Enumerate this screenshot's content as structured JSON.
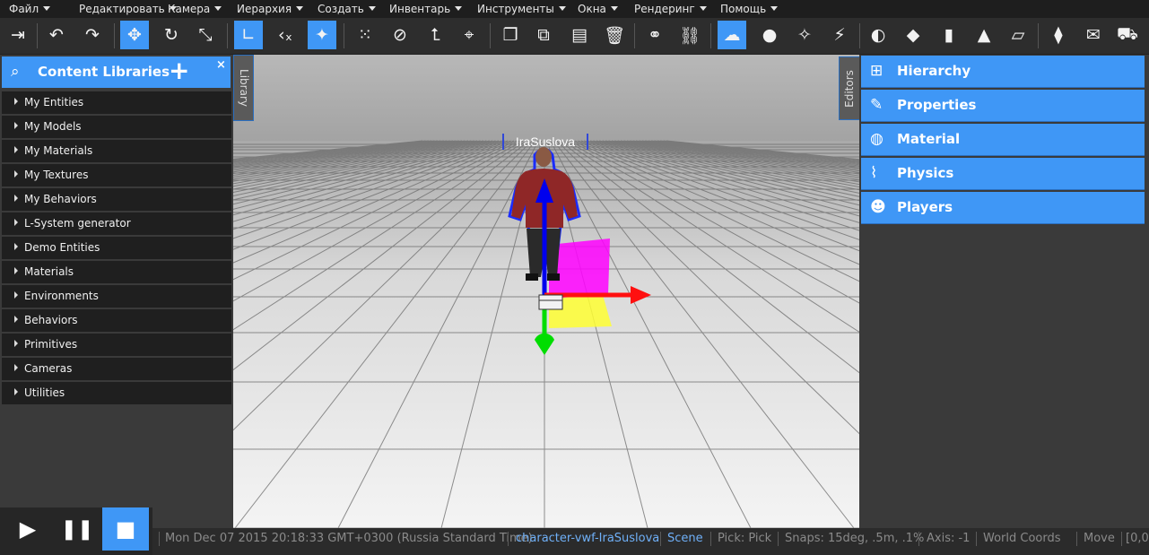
{
  "menu": [
    {
      "label": "Файл"
    },
    {
      "label": "Редактировать"
    },
    {
      "label": "Камера"
    },
    {
      "label": "Иерархия"
    },
    {
      "label": "Создать"
    },
    {
      "label": "Инвентарь"
    },
    {
      "label": "Инструменты"
    },
    {
      "label": "Окна"
    },
    {
      "label": "Рендеринг"
    },
    {
      "label": "Помощь"
    }
  ],
  "toolbar": {
    "active_color": "#3f97f6",
    "buttons": [
      {
        "icon": "logout-icon",
        "active": false
      },
      {
        "icon": "undo-icon",
        "active": false
      },
      {
        "icon": "redo-icon",
        "active": false
      },
      {
        "icon": "move-icon",
        "active": true
      },
      {
        "icon": "rotate-icon",
        "active": false
      },
      {
        "icon": "scale-icon",
        "active": false
      },
      {
        "icon": "local-axis-icon",
        "active": true
      },
      {
        "icon": "parent-axis-icon",
        "active": false
      },
      {
        "icon": "world-axis-icon",
        "active": true
      },
      {
        "icon": "snap-grid-icon",
        "active": false
      },
      {
        "icon": "no-snap-icon",
        "active": false
      },
      {
        "icon": "pick-icon",
        "active": false
      },
      {
        "icon": "target-icon",
        "active": false
      },
      {
        "icon": "copy-icon",
        "active": false
      },
      {
        "icon": "duplicate-icon",
        "active": false
      },
      {
        "icon": "paste-icon",
        "active": false
      },
      {
        "icon": "delete-icon",
        "active": false
      },
      {
        "icon": "link-icon",
        "active": false
      },
      {
        "icon": "unlink-icon",
        "active": false
      },
      {
        "icon": "camera-fly-icon",
        "active": true
      },
      {
        "icon": "avatar-icon",
        "active": false
      },
      {
        "icon": "light-icon",
        "active": false
      },
      {
        "icon": "particles-icon",
        "active": false
      },
      {
        "icon": "sphere-icon",
        "active": false
      },
      {
        "icon": "cube-icon",
        "active": false
      },
      {
        "icon": "cylinder-icon",
        "active": false
      },
      {
        "icon": "cone-icon",
        "active": false
      },
      {
        "icon": "plane-icon",
        "active": false
      },
      {
        "icon": "script-icon",
        "active": false
      },
      {
        "icon": "chat-icon",
        "active": false
      },
      {
        "icon": "cart-icon",
        "active": false
      }
    ]
  },
  "content_libraries": {
    "title": "Content Libraries",
    "close_label": "×",
    "items": [
      {
        "label": "My Entities"
      },
      {
        "label": "My Models"
      },
      {
        "label": "My Materials"
      },
      {
        "label": "My Textures"
      },
      {
        "label": "My Behaviors"
      },
      {
        "label": "L-System generator"
      },
      {
        "label": "Demo Entities"
      },
      {
        "label": "Materials"
      },
      {
        "label": "Environments"
      },
      {
        "label": "Behaviors"
      },
      {
        "label": "Primitives"
      },
      {
        "label": "Cameras"
      },
      {
        "label": "Utilities"
      }
    ]
  },
  "library_tab": "Library",
  "editors_tab": "Editors",
  "viewport": {
    "object_label": "IraSuslova"
  },
  "editors": [
    {
      "label": "Hierarchy",
      "icon": "hierarchy-icon"
    },
    {
      "label": "Properties",
      "icon": "properties-icon"
    },
    {
      "label": "Material",
      "icon": "material-icon"
    },
    {
      "label": "Physics",
      "icon": "physics-icon"
    },
    {
      "label": "Players",
      "icon": "players-icon"
    }
  ],
  "status": {
    "datetime": "Mon Dec 07 2015 20:18:33 GMT+0300 (Russia Standard Time)",
    "selected": "character-vwf-IraSuslova",
    "mode": "Scene",
    "pick": "Pick: Pick",
    "snaps": "Snaps: 15deg, .5m, .1%",
    "axis": "Axis: -1",
    "coords": "World Coords",
    "tool": "Move",
    "extra": "[0,0"
  }
}
